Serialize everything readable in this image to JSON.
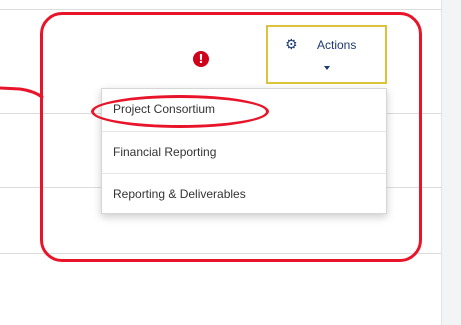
{
  "colors": {
    "annotation_red": "#e8152a",
    "alert_red": "#d0021b",
    "button_text_navy": "#1e3a6e",
    "button_border_yellow": "#dcc43a",
    "divider_gray": "#dcdcdc"
  },
  "header": {
    "alert_icon": "exclamation-circle-icon",
    "alert_glyph": "!"
  },
  "actions_button": {
    "icon": "gears-icon",
    "label": "Actions",
    "caret_icon": "caret-down-icon"
  },
  "dropdown": {
    "items": [
      {
        "label": "Project Consortium",
        "highlighted": true
      },
      {
        "label": "Financial Reporting"
      },
      {
        "label": "Reporting & Deliverables"
      }
    ]
  }
}
